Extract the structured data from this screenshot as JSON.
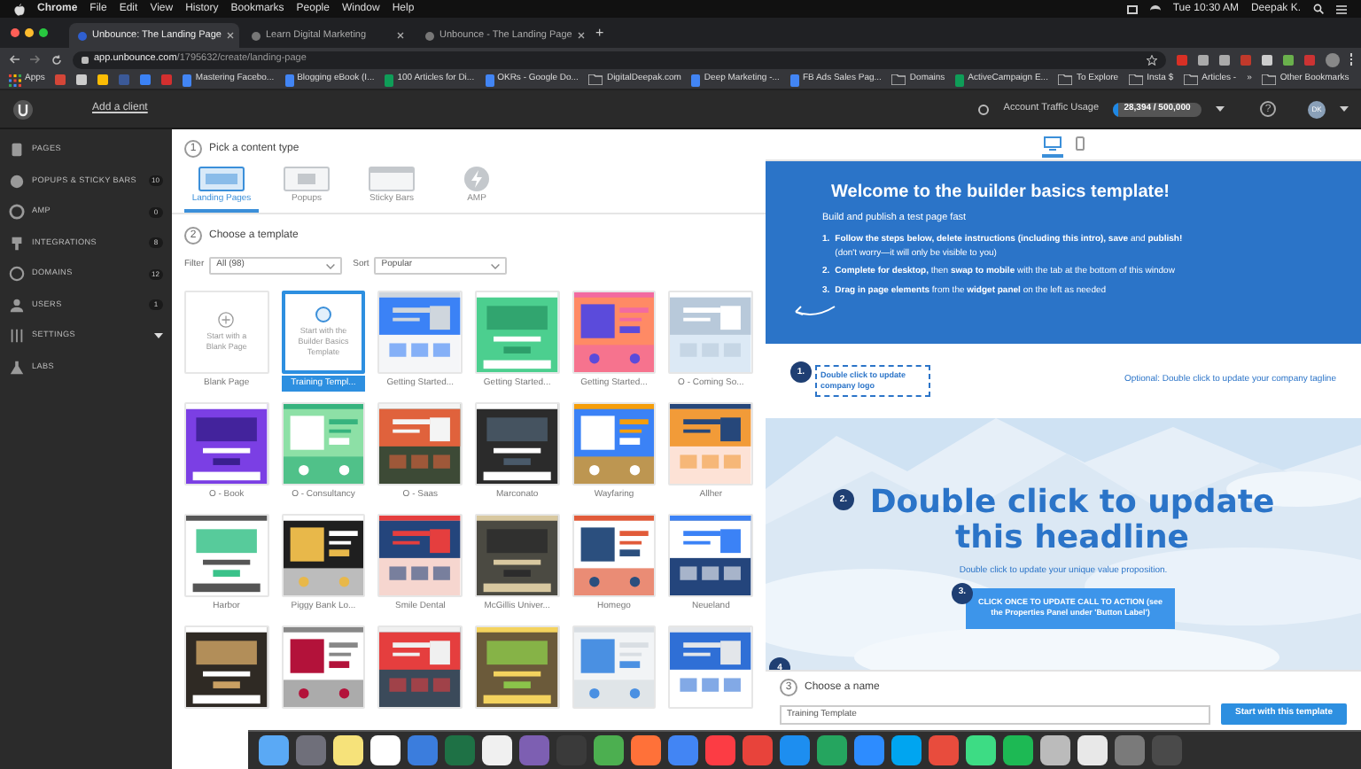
{
  "menu_bar": {
    "items": [
      "Chrome",
      "File",
      "Edit",
      "View",
      "History",
      "Bookmarks",
      "People",
      "Window",
      "Help"
    ],
    "clock": "Tue 10:30 AM",
    "user": "Deepak K."
  },
  "tabs": [
    {
      "label": "Unbounce: The Landing Page",
      "selected": true
    },
    {
      "label": "Learn Digital Marketing",
      "selected": false
    },
    {
      "label": "Unbounce - The Landing Page",
      "selected": false
    }
  ],
  "new_tab": "+",
  "address": {
    "domain": "app.unbounce.com",
    "path": "/1795632/create/landing-page"
  },
  "bookmarks": [
    {
      "label": "Apps",
      "kind": "apps"
    },
    {
      "label": "Mastering Facebo...",
      "kind": "doc"
    },
    {
      "label": "Blogging eBook (I...",
      "kind": "doc"
    },
    {
      "label": "100 Articles for Di...",
      "kind": "sheet"
    },
    {
      "label": "OKRs - Google Do...",
      "kind": "doc"
    },
    {
      "label": "DigitalDeepak.com",
      "kind": "folder"
    },
    {
      "label": "Deep Marketing -...",
      "kind": "doc"
    },
    {
      "label": "FB Ads Sales Pag...",
      "kind": "doc"
    },
    {
      "label": "Domains",
      "kind": "folder"
    },
    {
      "label": "ActiveCampaign E...",
      "kind": "sheet"
    },
    {
      "label": "To Explore",
      "kind": "folder"
    },
    {
      "label": "Insta $",
      "kind": "folder"
    },
    {
      "label": "Articles -",
      "kind": "folder"
    },
    {
      "label": "»",
      "kind": "more"
    },
    {
      "label": "Other Bookmarks",
      "kind": "folder"
    }
  ],
  "header": {
    "add_client": "Add a client",
    "traffic_label": "Account Traffic Usage",
    "traffic": {
      "reading": "28,394 / 500,000",
      "level": 0.057
    },
    "avatar": "DK",
    "help": "?"
  },
  "sidebar": {
    "items": [
      {
        "label": "PAGES",
        "kind": "plain"
      },
      {
        "label": "POPUPS & STICKY BARS",
        "kind": "count",
        "count": "10"
      },
      {
        "label": "AMP",
        "kind": "count",
        "count": "0"
      },
      {
        "label": "INTEGRATIONS",
        "kind": "count",
        "count": "8"
      },
      {
        "label": "DOMAINS",
        "kind": "count",
        "count": "12"
      },
      {
        "label": "USERS",
        "kind": "count",
        "count": "1"
      },
      {
        "label": "SETTINGS",
        "kind": "caret"
      },
      {
        "label": "LABS",
        "kind": "plain"
      }
    ]
  },
  "step1": {
    "number": "1",
    "title": "Pick a content type",
    "types": [
      {
        "label": "Landing Pages",
        "kind": "landing",
        "selected": true
      },
      {
        "label": "Popups",
        "kind": "popup",
        "selected": false
      },
      {
        "label": "Sticky Bars",
        "kind": "sticky",
        "selected": false
      },
      {
        "label": "AMP",
        "kind": "amp",
        "selected": false
      }
    ]
  },
  "step2": {
    "number": "2",
    "title": "Choose a template",
    "filter_label": "Filter",
    "filter_value": "All (98)",
    "sort_label": "Sort",
    "sort_value": "Popular",
    "templates": [
      {
        "label": "Blank Page",
        "kind": "blank",
        "text": "Start with a Blank Page",
        "selected": false
      },
      {
        "label": "Training Templ...",
        "kind": "builder",
        "text": "Start with the Builder Basics Template",
        "selected": true
      },
      {
        "label": "Getting Started...",
        "kind": "picture",
        "selected": false
      },
      {
        "label": "Getting Started...",
        "kind": "picture",
        "selected": false
      },
      {
        "label": "Getting Started...",
        "kind": "picture",
        "selected": false
      },
      {
        "label": "O - Coming So...",
        "kind": "picture",
        "selected": false
      },
      {
        "label": "O - Book",
        "kind": "picture",
        "selected": false
      },
      {
        "label": "O - Consultancy",
        "kind": "picture",
        "selected": false
      },
      {
        "label": "O - Saas",
        "kind": "picture",
        "selected": false
      },
      {
        "label": "Marconato",
        "kind": "picture",
        "selected": false
      },
      {
        "label": "Wayfaring",
        "kind": "picture",
        "selected": false
      },
      {
        "label": "Allher",
        "kind": "picture",
        "selected": false
      },
      {
        "label": "Harbor",
        "kind": "picture",
        "selected": false
      },
      {
        "label": "Piggy Bank Lo...",
        "kind": "picture",
        "selected": false
      },
      {
        "label": "Smile Dental",
        "kind": "picture",
        "selected": false
      },
      {
        "label": "McGillis Univer...",
        "kind": "picture",
        "selected": false
      },
      {
        "label": "Homego",
        "kind": "picture",
        "selected": false
      },
      {
        "label": "Neueland",
        "kind": "picture",
        "selected": false
      },
      {
        "kind": "picture",
        "selected": false
      },
      {
        "kind": "picture",
        "selected": false
      },
      {
        "kind": "picture",
        "selected": false
      },
      {
        "kind": "picture",
        "selected": false
      },
      {
        "kind": "picture",
        "selected": false
      },
      {
        "kind": "picture",
        "selected": false
      }
    ]
  },
  "preview": {
    "devices": [
      {
        "kind": "desktop",
        "selected": true
      },
      {
        "kind": "mobile",
        "selected": false
      }
    ],
    "intro": {
      "title": "Welcome to the builder basics template!",
      "subtitle": "Build and publish a test page fast",
      "steps": [
        {
          "number": "1.",
          "text": "**Follow the steps below, delete instructions (including this intro), save** and **publish!**",
          "note": "(don't worry—it will only be visible to you)"
        },
        {
          "number": "2.",
          "text": "**Complete for desktop,** then **swap to mobile** with the tab at the bottom of this window"
        },
        {
          "number": "3.",
          "text": "**Drag in page elements** from the **widget panel** on the left as needed"
        }
      ]
    },
    "logo_badge": "1.",
    "logo_text": "Double click to update company logo",
    "tagline": "Optional: Double click to update your company tagline",
    "headline_badge": "2.",
    "headline": "Double click to update this headline",
    "value_prop": "Double click to update your unique value proposition.",
    "cta_badge": "3.",
    "cta": "CLICK ONCE TO UPDATE CALL TO ACTION  (see the Properties Panel under 'Button Label')",
    "next_badge": "4"
  },
  "step3": {
    "number": "3",
    "title": "Choose a name",
    "name_value": "Training Template",
    "submit": "Start with this template"
  }
}
